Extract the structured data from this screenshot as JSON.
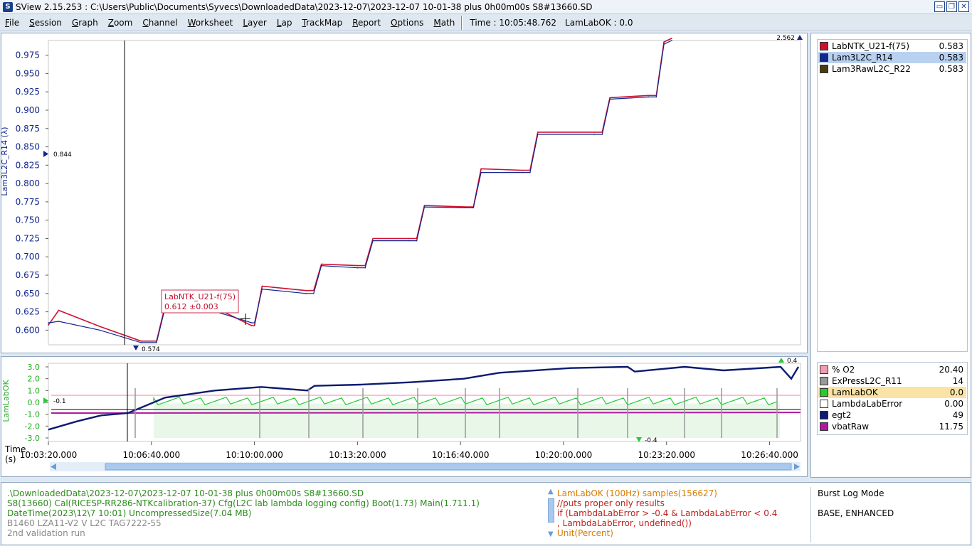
{
  "titlebar": {
    "app_icon": "S",
    "title": "SView 2.15.253  :  C:\\Users\\Public\\Documents\\Syvecs\\DownloadedData\\2023-12-07\\2023-12-07 10-01-38 plus 0h00m00s S8#13660.SD",
    "buttons": {
      "minimize": "▭",
      "restore": "❐",
      "close": "✕"
    }
  },
  "menu": [
    "File",
    "Session",
    "Graph",
    "Zoom",
    "Channel",
    "Worksheet",
    "Layer",
    "Lap",
    "TrackMap",
    "Report",
    "Options",
    "Math"
  ],
  "status": {
    "time": "Time : 10:05:48.762",
    "lamlabok": "LamLabOK : 0.0"
  },
  "top_legend": [
    {
      "name": "LabNTK_U21-f(75)",
      "value": "0.583",
      "color": "#d0102f",
      "selected": false
    },
    {
      "name": "Lam3L2C_R14",
      "value": "0.583",
      "color": "#13268f",
      "selected": true
    },
    {
      "name": "Lam3RawL2C_R22",
      "value": "0.583",
      "color": "#4a3b12",
      "selected": false
    }
  ],
  "bottom_legend": [
    {
      "name": "% O2",
      "value": "20.40",
      "color": "#f29cb4",
      "selected": false
    },
    {
      "name": "ExPressL2C_R11",
      "value": "14",
      "color": "#999999",
      "selected": false
    },
    {
      "name": "LamLabOK",
      "value": "0.0",
      "color": "#22cc33",
      "selected": true
    },
    {
      "name": "LambdaLabError",
      "value": "0.00",
      "color": "#ffffff",
      "selected": false
    },
    {
      "name": "egt2",
      "value": "49",
      "color": "#0c1a70",
      "selected": false
    },
    {
      "name": "vbatRaw",
      "value": "11.75",
      "color": "#b01aa0",
      "selected": false
    }
  ],
  "top_graph": {
    "ylabel": "Lam3L2C_R14 (λ)",
    "yticks": [
      "0.975",
      "0.950",
      "0.925",
      "0.900",
      "0.875",
      "0.850",
      "0.825",
      "0.800",
      "0.775",
      "0.750",
      "0.725",
      "0.700",
      "0.675",
      "0.650",
      "0.625",
      "0.600"
    ],
    "max_marker": "2.562",
    "left_marker": "0.844",
    "min_marker": "0.574",
    "tooltip_name": "LabNTK_U21-f(75)",
    "tooltip_value": "0.612 ±0.003"
  },
  "bottom_graph": {
    "ylabel": "LamLabOK",
    "yticks": [
      "3.0",
      "2.0",
      "1.0",
      "0.0",
      "-1.0",
      "-2.0",
      "-3.0"
    ],
    "left_marker": "-0.1",
    "max_marker": "0.4",
    "min_marker": "-0.4"
  },
  "time_axis": {
    "label_line1": "Time",
    "label_line2": "(s)",
    "ticks": [
      "10:03:20.000",
      "10:06:40.000",
      "10:10:00.000",
      "10:13:20.000",
      "10:16:40.000",
      "10:20:00.000",
      "10:23:20.000",
      "10:26:40.000"
    ]
  },
  "chart_data": {
    "type": "line",
    "x_unit": "time",
    "x_range": [
      "10:03:20",
      "10:27:40"
    ],
    "ylim": [
      0.58,
      0.995
    ],
    "series": [
      {
        "name": "LabNTK_U21-f(75)",
        "x": [
          "10:03:20",
          "10:03:40",
          "10:05:00",
          "10:06:20",
          "10:06:50",
          "10:07:10",
          "10:07:40",
          "10:09:00",
          "10:09:55",
          "10:10:00",
          "10:10:15",
          "10:11:40",
          "10:11:55",
          "10:12:10",
          "10:13:20",
          "10:13:35",
          "10:13:50",
          "10:15:00",
          "10:15:15",
          "10:15:30",
          "10:16:50",
          "10:17:05",
          "10:17:20",
          "10:18:40",
          "10:18:55",
          "10:19:10",
          "10:21:00",
          "10:21:15",
          "10:21:30",
          "10:22:45",
          "10:23:00",
          "10:23:15",
          "10:23:30"
        ],
        "values": [
          0.607,
          0.627,
          0.605,
          0.585,
          0.585,
          0.643,
          0.641,
          0.625,
          0.606,
          0.606,
          0.66,
          0.654,
          0.654,
          0.69,
          0.688,
          0.688,
          0.725,
          0.725,
          0.725,
          0.77,
          0.768,
          0.768,
          0.82,
          0.818,
          0.818,
          0.87,
          0.87,
          0.87,
          0.917,
          0.92,
          0.92,
          0.993,
          0.998
        ]
      },
      {
        "name": "Lam3L2C_R14",
        "x": [
          "10:03:20",
          "10:03:40",
          "10:05:00",
          "10:06:20",
          "10:06:50",
          "10:07:10",
          "10:07:40",
          "10:09:00",
          "10:09:55",
          "10:10:00",
          "10:10:15",
          "10:11:40",
          "10:11:55",
          "10:12:10",
          "10:13:20",
          "10:13:35",
          "10:13:50",
          "10:15:00",
          "10:15:15",
          "10:15:30",
          "10:16:50",
          "10:17:05",
          "10:17:20",
          "10:18:40",
          "10:18:55",
          "10:19:10",
          "10:21:00",
          "10:21:15",
          "10:21:30",
          "10:22:45",
          "10:23:00",
          "10:23:15",
          "10:23:30"
        ],
        "values": [
          0.61,
          0.612,
          0.6,
          0.583,
          0.583,
          0.64,
          0.637,
          0.622,
          0.61,
          0.61,
          0.656,
          0.65,
          0.65,
          0.688,
          0.685,
          0.685,
          0.722,
          0.722,
          0.722,
          0.768,
          0.767,
          0.767,
          0.815,
          0.815,
          0.815,
          0.867,
          0.867,
          0.867,
          0.915,
          0.918,
          0.918,
          0.99,
          0.995
        ]
      }
    ],
    "cursor_time": "10:05:48.762",
    "legend": "right panel"
  },
  "info": {
    "left_lines": [
      ".\\DownloadedData\\2023-12-07\\2023-12-07 10-01-38 plus 0h00m00s S8#13660.SD",
      "S8(13660) Cal(RICESP-RR286-NTKcalibration-37) Cfg(L2C lab lambda logging config) Boot(1.73) Main(1.711.1)",
      "DateTime(2023\\12\\7 10:01) UncompressedSize(7.04 MB)",
      "B1460 LZA11-V2 V L2C TAG7222-55",
      "2nd validation run"
    ],
    "math_lines": [
      "LamLabOK (100Hz) samples(156627)",
      "//puts proper only results",
      "if (LambdaLabError > -0.4 & LambdaLabError < 0.4",
      ", LambdaLabError, undefined())",
      "Unit(Percent)"
    ],
    "right_lines": [
      "Burst Log Mode",
      "",
      "BASE, ENHANCED"
    ]
  }
}
